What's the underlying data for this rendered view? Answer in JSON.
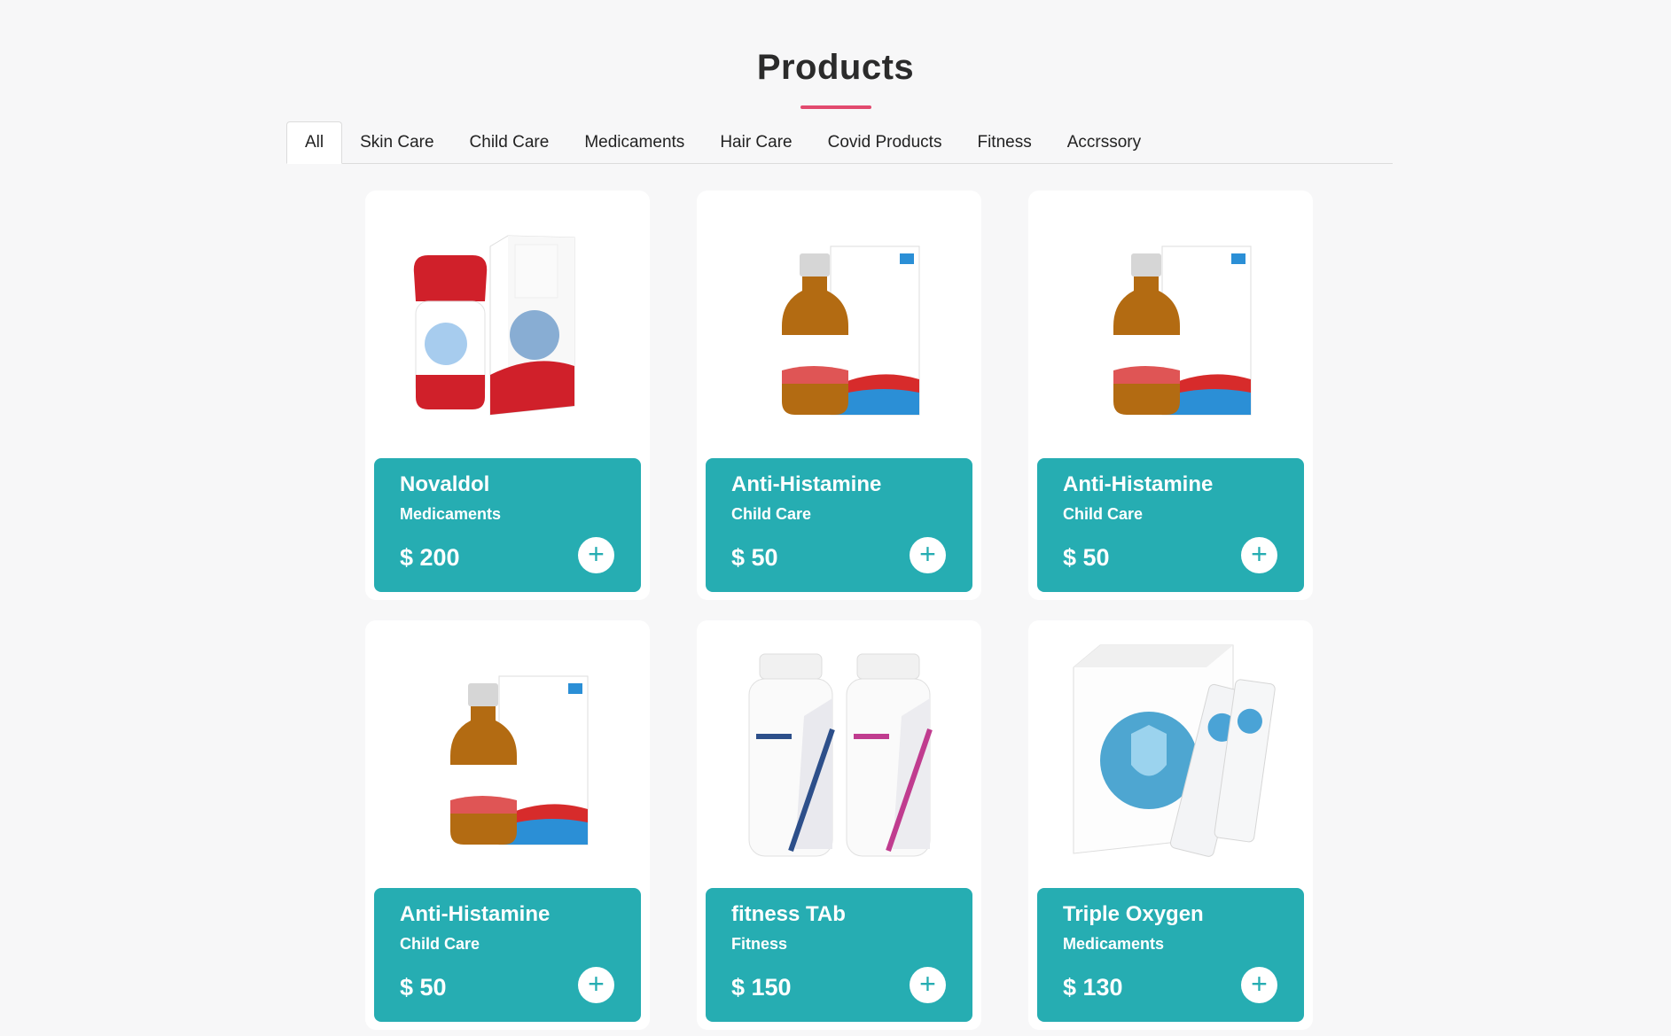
{
  "page": {
    "title": "Products"
  },
  "tabs": [
    {
      "label": "All",
      "active": true
    },
    {
      "label": "Skin Care"
    },
    {
      "label": "Child Care"
    },
    {
      "label": "Medicaments"
    },
    {
      "label": "Hair Care"
    },
    {
      "label": "Covid Products"
    },
    {
      "label": "Fitness"
    },
    {
      "label": "Accrssory"
    }
  ],
  "products": [
    {
      "name": "Novaldol",
      "category": "Medicaments",
      "price": "$ 200",
      "image_icon": "lotion-bottle-and-box"
    },
    {
      "name": "Anti-Histamine",
      "category": "Child Care",
      "price": "$ 50",
      "image_icon": "syrup-bottle-and-box"
    },
    {
      "name": "Anti-Histamine",
      "category": "Child Care",
      "price": "$ 50",
      "image_icon": "syrup-bottle-and-box"
    },
    {
      "name": "Anti-Histamine",
      "category": "Child Care",
      "price": "$ 50",
      "image_icon": "syrup-bottle-and-box"
    },
    {
      "name": "fitness TAb",
      "category": "Fitness",
      "price": "$ 150",
      "image_icon": "supplement-jars"
    },
    {
      "name": "Triple Oxygen",
      "category": "Medicaments",
      "price": "$ 130",
      "image_icon": "powder-sachet-box"
    }
  ],
  "add_button_symbol": "+",
  "colors": {
    "accent": "#26adb2",
    "underline": "#e24a6f"
  }
}
